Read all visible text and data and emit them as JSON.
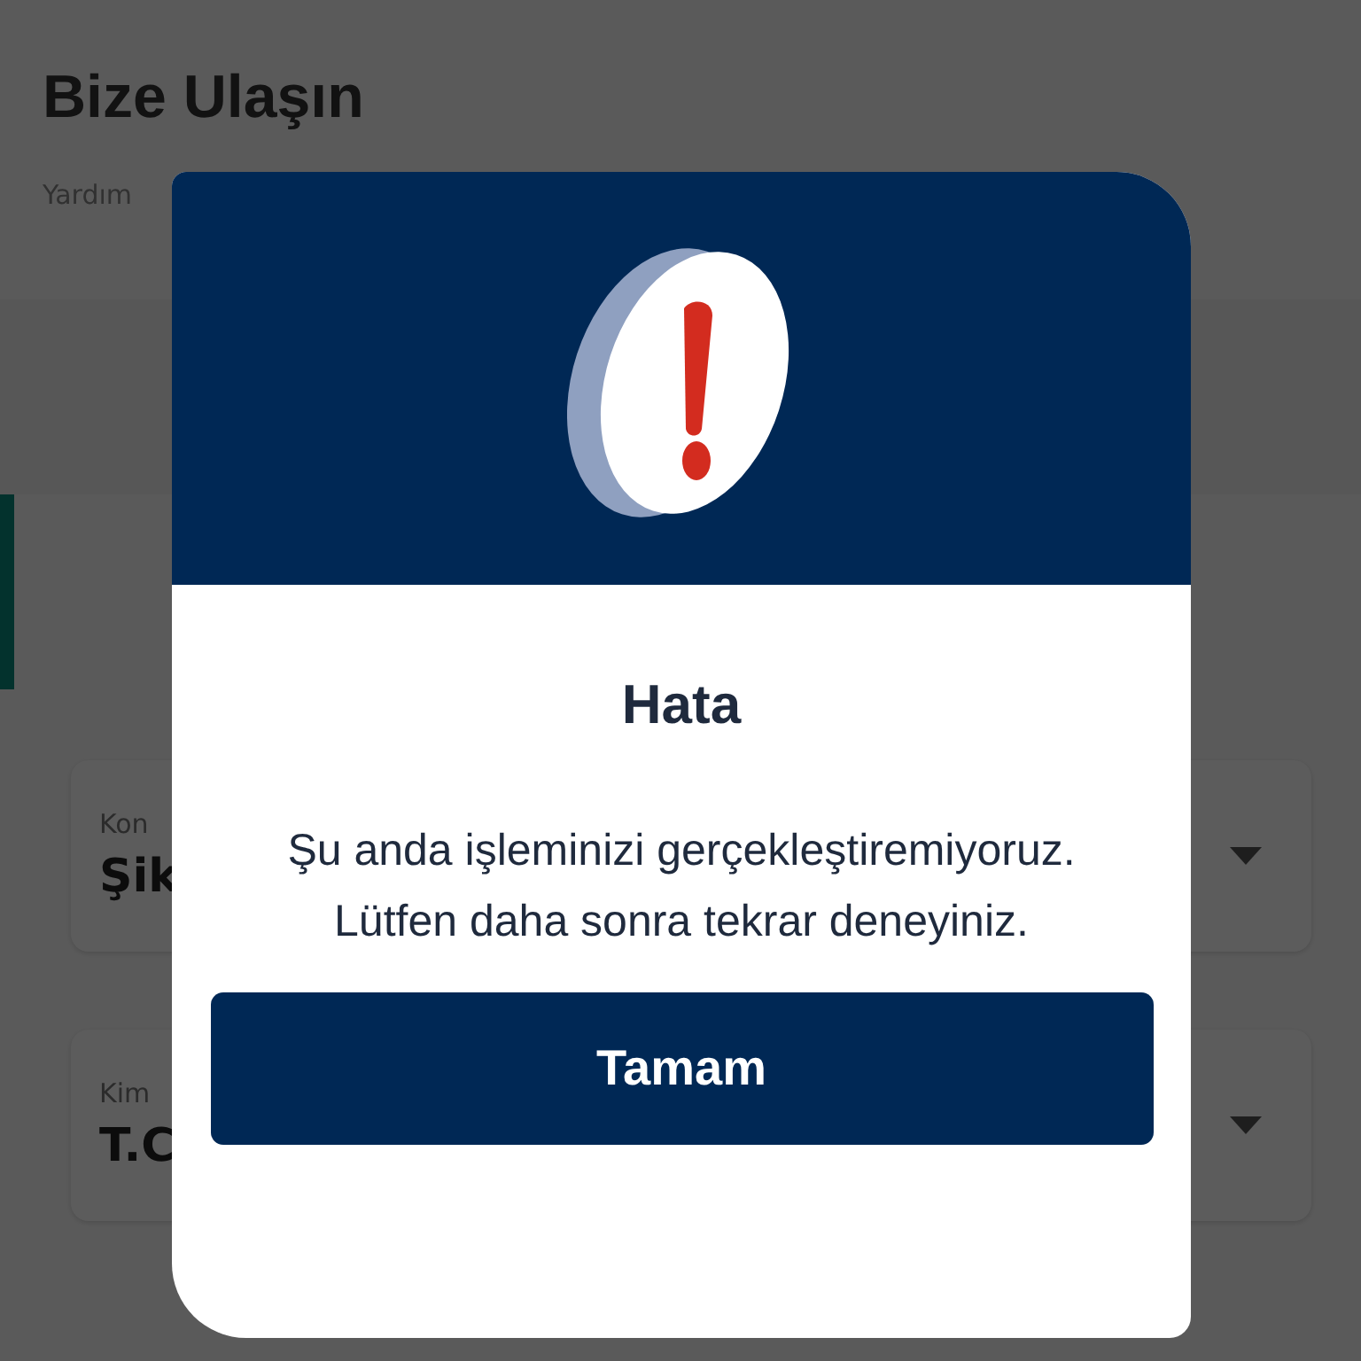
{
  "page": {
    "title": "Bize Ulaşın",
    "subtitle": "Yardım",
    "fields": [
      {
        "label": "Kon",
        "value": "Şik"
      },
      {
        "label": "Kim",
        "value": "T.C"
      }
    ]
  },
  "dialog": {
    "title": "Hata",
    "message": "Şu anda işleminizi gerçekleştiremiyoruz. Lütfen daha sonra tekrar deneyiniz.",
    "button": "Tamam"
  }
}
